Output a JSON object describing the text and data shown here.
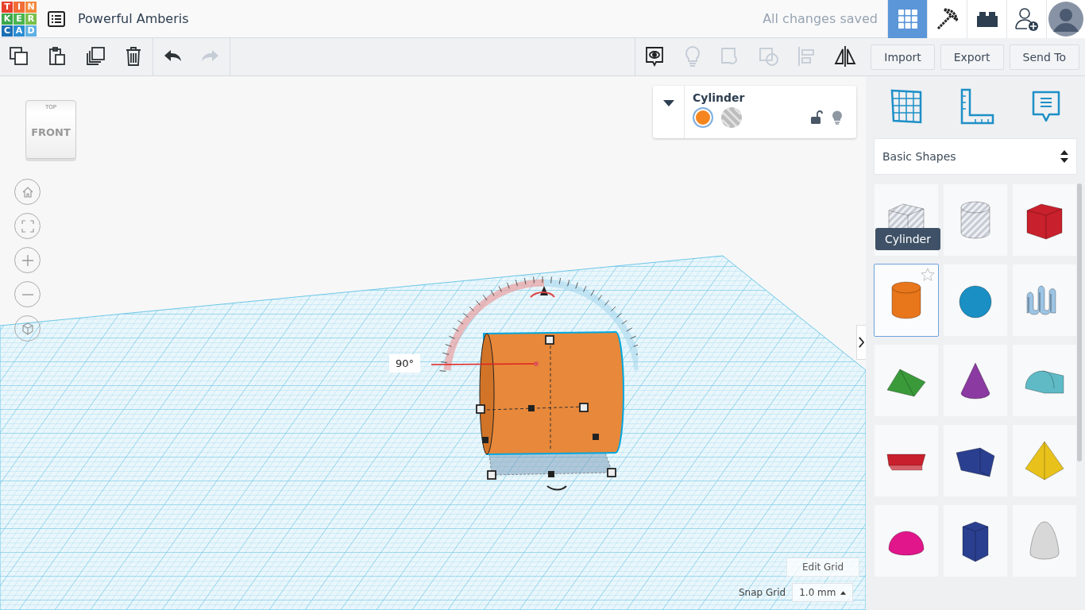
{
  "logo": {
    "letters": [
      {
        "char": "T",
        "color": "#e8412b"
      },
      {
        "char": "I",
        "color": "#f26d36"
      },
      {
        "char": "N",
        "color": "#f5893b"
      },
      {
        "char": "K",
        "color": "#3ca84a"
      },
      {
        "char": "E",
        "color": "#4bb450"
      },
      {
        "char": "R",
        "color": "#79c04a"
      },
      {
        "char": "C",
        "color": "#1b6fb5"
      },
      {
        "char": "A",
        "color": "#2a8dd2"
      },
      {
        "char": "D",
        "color": "#5fb1e3"
      }
    ]
  },
  "project_title": "Powerful Amberis",
  "save_status": "All changes saved",
  "nav_tabs": [
    {
      "kind": "design",
      "selected": true
    },
    {
      "kind": "blocks",
      "selected": false
    },
    {
      "kind": "bricks",
      "selected": false
    }
  ],
  "edit_tools": [
    {
      "kind": "copy",
      "disabled": false
    },
    {
      "kind": "paste",
      "disabled": false
    },
    {
      "kind": "duplicate",
      "disabled": false
    },
    {
      "kind": "delete",
      "disabled": false
    },
    {
      "kind": "undo",
      "disabled": false
    },
    {
      "kind": "redo",
      "disabled": true
    }
  ],
  "view_tools": [
    {
      "kind": "notes",
      "disabled": false
    },
    {
      "kind": "bulb",
      "disabled": true
    },
    {
      "kind": "group",
      "disabled": true
    },
    {
      "kind": "ungroup",
      "disabled": true
    },
    {
      "kind": "align",
      "disabled": true
    },
    {
      "kind": "mirror",
      "disabled": false
    }
  ],
  "action_buttons": [
    "Import",
    "Export",
    "Send To"
  ],
  "inspector": {
    "title": "Cylinder",
    "options": [
      {
        "kind": "solid",
        "color": "#f5851f",
        "selected": true
      },
      {
        "kind": "hole",
        "color": "#bdbdbd",
        "selected": false
      }
    ]
  },
  "view_cube": {
    "top": "TOP",
    "front": "FRONT"
  },
  "angle_label": "90°",
  "edit_grid": "Edit Grid",
  "snap_grid": {
    "label": "Snap Grid",
    "value": "1.0 mm"
  },
  "library": {
    "category": "Basic Shapes",
    "tooltip": "Cylinder",
    "shapes": [
      {
        "kind": "box",
        "color": "#c5cad3",
        "hole": true,
        "selected": false
      },
      {
        "kind": "cylinder",
        "color": "#c5cad3",
        "hole": true,
        "selected": false
      },
      {
        "kind": "box",
        "color": "#c8202c",
        "hole": false,
        "selected": false
      },
      {
        "kind": "cylinder",
        "color": "#e8761a",
        "hole": false,
        "selected": true
      },
      {
        "kind": "sphere",
        "color": "#1a8fc4",
        "hole": false,
        "selected": false
      },
      {
        "kind": "scribble",
        "color": "#9cc4e4",
        "hole": false,
        "selected": false
      },
      {
        "kind": "roof",
        "color": "#3a9a3a",
        "hole": false,
        "selected": false
      },
      {
        "kind": "cone",
        "color": "#8a3aa0",
        "hole": false,
        "selected": false
      },
      {
        "kind": "round-roof",
        "color": "#5fbac6",
        "hole": false,
        "selected": false
      },
      {
        "kind": "text",
        "color": "#c8202c",
        "hole": false,
        "selected": false
      },
      {
        "kind": "wedge",
        "color": "#2a3f8f",
        "hole": false,
        "selected": false
      },
      {
        "kind": "pyramid",
        "color": "#e8c21a",
        "hole": false,
        "selected": false
      },
      {
        "kind": "half-sphere",
        "color": "#e0168a",
        "hole": false,
        "selected": false
      },
      {
        "kind": "polygon",
        "color": "#2a3f8f",
        "hole": false,
        "selected": false
      },
      {
        "kind": "paraboloid",
        "color": "#d8d8d8",
        "hole": false,
        "selected": false
      }
    ]
  }
}
